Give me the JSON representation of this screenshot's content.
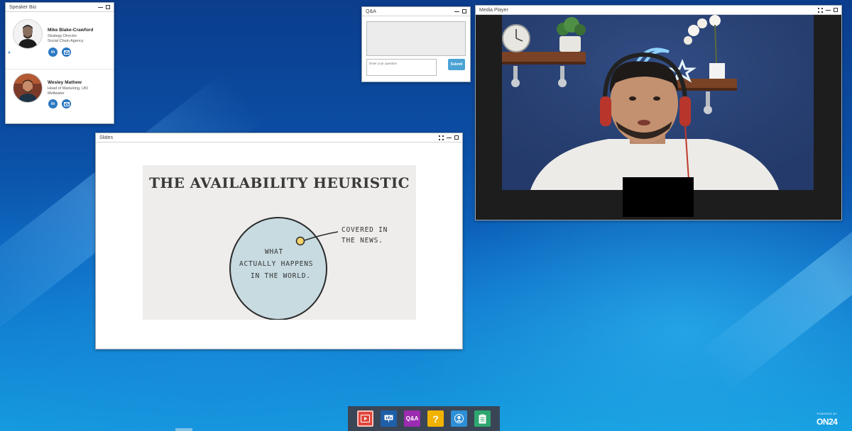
{
  "speaker_bio": {
    "title": "Speaker Bio",
    "speakers": [
      {
        "name": "Mike Blake-Crawford",
        "role": "Strategy Director",
        "org": "Social Chain Agency"
      },
      {
        "name": "Wesley Mathew",
        "role": "Head of Marketing, UKI",
        "org": "Meltwater"
      }
    ],
    "linkedin_label": "in"
  },
  "qa": {
    "title": "Q&A",
    "input_placeholder": "Enter your question",
    "submit_label": "Submit"
  },
  "media_player": {
    "title": "Media Player"
  },
  "slides": {
    "title": "Slides",
    "slide_title": "THE AVAILABILITY HEURISTIC",
    "circle_text": [
      "What",
      "Actually Happens",
      "in the World."
    ],
    "annotation": [
      "Covered in",
      "the News."
    ]
  },
  "taskbar": {
    "items": [
      {
        "name": "media-player",
        "label": "",
        "color": "#e0453b"
      },
      {
        "name": "slides",
        "label": "",
        "color": "#1e5fa8"
      },
      {
        "name": "qa",
        "label": "Q&A",
        "color": "#9b2bb0"
      },
      {
        "name": "help",
        "label": "?",
        "color": "#f2b300"
      },
      {
        "name": "speaker-bio",
        "label": "",
        "color": "#2e8fd6"
      },
      {
        "name": "resources",
        "label": "",
        "color": "#2ea66f"
      }
    ]
  },
  "branding": {
    "powered_by": "POWERED BY",
    "logo": "ON24"
  }
}
